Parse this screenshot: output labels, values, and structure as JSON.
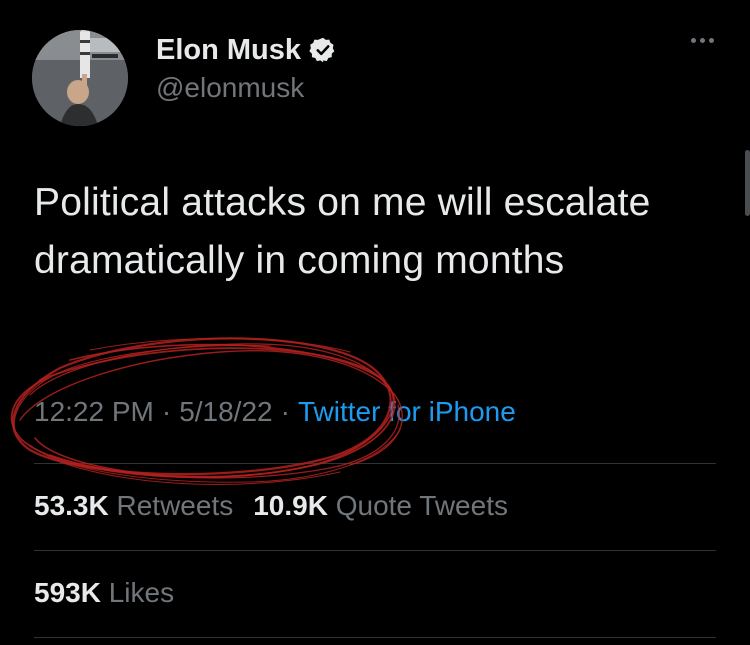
{
  "author": {
    "name": "Elon Musk",
    "handle": "@elonmusk"
  },
  "tweet": {
    "text": "Political attacks on me will escalate dramatically in coming months",
    "time": "12:22 PM",
    "date": "5/18/22",
    "separator": "·",
    "source": "Twitter for iPhone"
  },
  "stats": {
    "retweets_count": "53.3K",
    "retweets_label": "Retweets",
    "quotes_count": "10.9K",
    "quotes_label": "Quote Tweets",
    "likes_count": "593K",
    "likes_label": "Likes"
  },
  "colors": {
    "background": "#000000",
    "text": "#e7e9ea",
    "secondary": "#71767b",
    "link": "#1d9bf0",
    "divider": "#2f3336",
    "annotation": "#b3211f"
  },
  "icons": {
    "verified": "verified-badge-icon",
    "more": "more-options-icon"
  }
}
